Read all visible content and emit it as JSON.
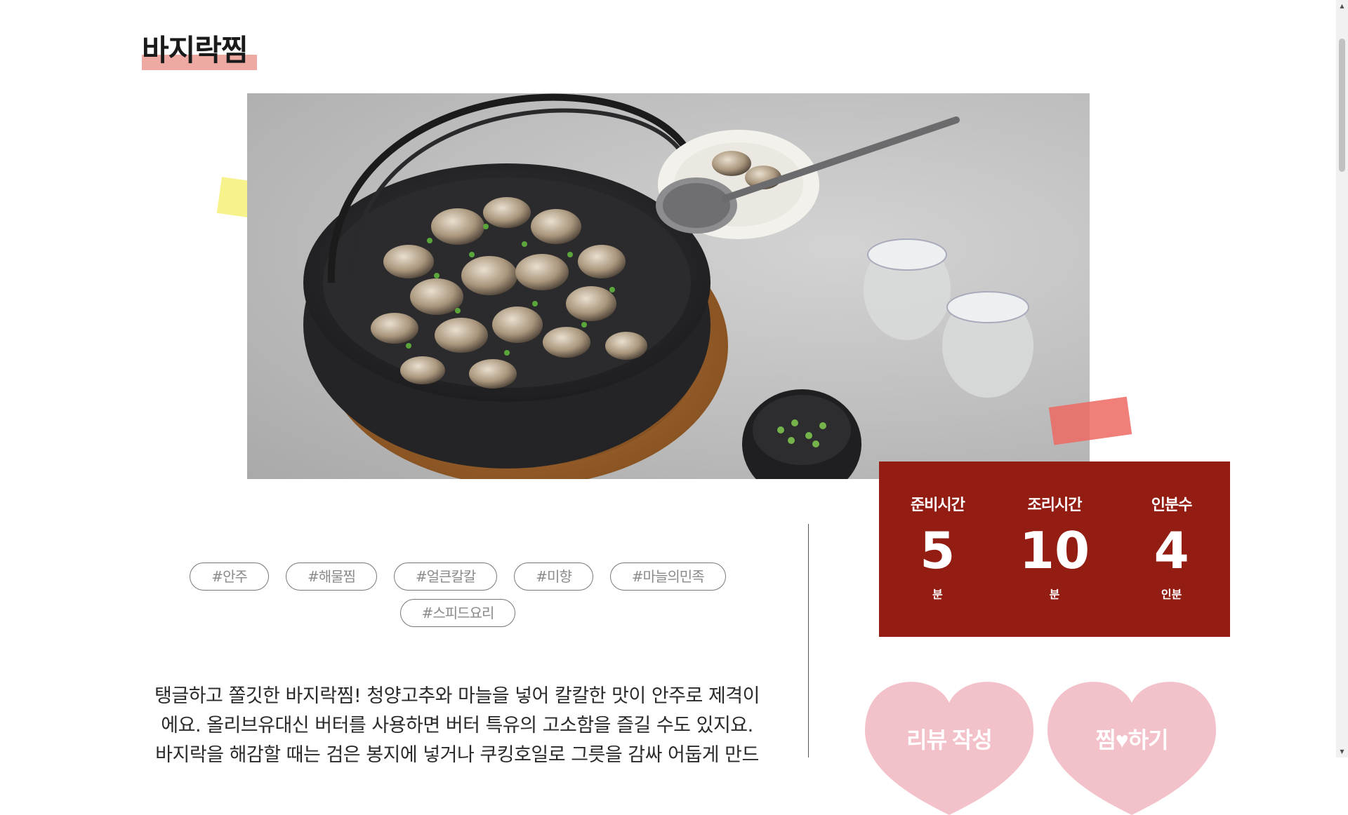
{
  "recipe": {
    "title": "바지락찜",
    "photo_alt": "",
    "tags": [
      "#안주",
      "#해물찜",
      "#얼큰칼칼",
      "#미향",
      "#마늘의민족",
      "#스피드요리"
    ],
    "description": "탱글하고 쫄깃한 바지락찜! 청양고추와 마늘을 넣어 칼칼한 맛이 안주로 제격이에요. 올리브유대신 버터를 사용하면 버터 특유의 고소함을 즐길 수도 있지요. 바지락을 해감할 때는 검은 봉지에 넣거나 쿠킹호일로 그릇을 감싸 어둡게 만드"
  },
  "info": {
    "prep": {
      "label": "준비시간",
      "value": "5",
      "unit": "분"
    },
    "cook": {
      "label": "조리시간",
      "value": "10",
      "unit": "분"
    },
    "serving": {
      "label": "인분수",
      "value": "4",
      "unit": "인분"
    }
  },
  "actions": {
    "review_label": "리뷰 작성",
    "like_prefix": "찜",
    "like_heart": "♥",
    "like_suffix": "하기"
  },
  "colors": {
    "info_bg": "#931c13",
    "heart_pink": "#f3c1c9",
    "title_highlight": "#eeaaa2",
    "tag_border": "#777777",
    "sticky_yellow": "#f6f078",
    "sticky_red": "#ed6961"
  },
  "icons": {
    "scroll_up": "triangle-up-icon",
    "scroll_down": "triangle-down-icon",
    "heart": "heart-icon"
  }
}
